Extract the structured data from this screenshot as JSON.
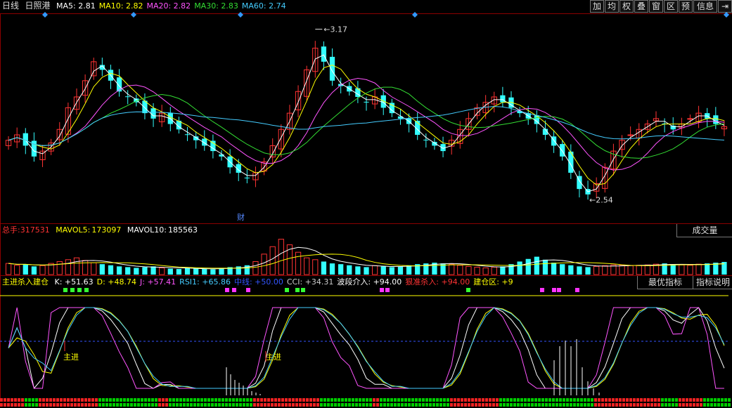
{
  "header": {
    "period": "日线",
    "stock": "日照港",
    "ma": [
      {
        "label": "MA5:",
        "value": "2.81",
        "color": "#ffffff"
      },
      {
        "label": "MA10:",
        "value": "2.82",
        "color": "#ffff00"
      },
      {
        "label": "MA20:",
        "value": "2.82",
        "color": "#ff55ff"
      },
      {
        "label": "MA30:",
        "value": "2.83",
        "color": "#33dd33"
      },
      {
        "label": "MA60:",
        "value": "2.74",
        "color": "#44ccff"
      }
    ]
  },
  "toolbar": {
    "items": [
      "加",
      "均",
      "权",
      "叠",
      "窗",
      "区",
      "预",
      "信息"
    ],
    "exit_icon": "exit-arrow-icon"
  },
  "main_chart": {
    "high_label": "3.17",
    "low_label": "2.54",
    "finance_marker": "财"
  },
  "volume_panel": {
    "total_label": "总手:",
    "total_value": "317531",
    "mavol5_label": "MAVOL5:",
    "mavol5_value": "173097",
    "mavol10_label": "MAVOL10:",
    "mavol10_value": "185563",
    "button": "成交量"
  },
  "indicator_panel": {
    "name": "主进杀入建仓",
    "items": [
      {
        "label": "K:",
        "value": "+51.63",
        "color": "#ffffff"
      },
      {
        "label": "D:",
        "value": "+48.74",
        "color": "#ffff00"
      },
      {
        "label": "J:",
        "value": "+57.41",
        "color": "#ff55ff"
      },
      {
        "label": "RSI1:",
        "value": "+65.86",
        "color": "#44ccff"
      },
      {
        "label": "中线:",
        "value": "+50.00",
        "color": "#3355ff"
      },
      {
        "label": "CCI:",
        "value": "+34.31",
        "color": "#cccccc"
      },
      {
        "label": "波段介入:",
        "value": "+94.00",
        "color": "#ffffff"
      },
      {
        "label": "狠准杀入:",
        "value": "+94.00",
        "color": "#ff3333"
      },
      {
        "label": "建仓区:",
        "value": "+9",
        "color": "#ffff00"
      }
    ],
    "button_best": "最优指标",
    "button_help": "指标说明",
    "annotations": [
      "主进",
      "主进"
    ]
  },
  "colors": {
    "up": "#ff3333",
    "down": "#33ffff",
    "ma5": "#ffffff",
    "ma10": "#ffff00",
    "ma20": "#ff55ff",
    "ma30": "#33dd33",
    "ma60": "#44ccff"
  },
  "chart_data": {
    "type": "candlestick",
    "yaxis_labels_shown": [
      "3.17",
      "2.54"
    ],
    "high": 3.17,
    "low": 2.54,
    "closes": [
      2.76,
      2.78,
      2.74,
      2.7,
      2.72,
      2.75,
      2.8,
      2.88,
      2.92,
      2.98,
      3.05,
      3.02,
      2.98,
      2.94,
      2.92,
      2.9,
      2.86,
      2.84,
      2.86,
      2.82,
      2.8,
      2.78,
      2.76,
      2.74,
      2.72,
      2.7,
      2.66,
      2.64,
      2.62,
      2.64,
      2.68,
      2.74,
      2.8,
      2.86,
      2.94,
      3.02,
      3.1,
      3.05,
      2.98,
      2.96,
      2.94,
      2.92,
      2.9,
      2.92,
      2.88,
      2.86,
      2.84,
      2.82,
      2.78,
      2.76,
      2.74,
      2.72,
      2.76,
      2.8,
      2.84,
      2.88,
      2.9,
      2.92,
      2.9,
      2.88,
      2.86,
      2.84,
      2.82,
      2.78,
      2.74,
      2.7,
      2.64,
      2.58,
      2.56,
      2.6,
      2.66,
      2.72,
      2.76,
      2.78,
      2.8,
      2.82,
      2.84,
      2.82,
      2.8,
      2.82,
      2.84,
      2.86,
      2.84,
      2.82,
      2.81
    ],
    "volume": [
      0.3,
      0.25,
      0.28,
      0.22,
      0.24,
      0.3,
      0.35,
      0.4,
      0.45,
      0.38,
      0.32,
      0.28,
      0.25,
      0.22,
      0.2,
      0.18,
      0.2,
      0.22,
      0.18,
      0.16,
      0.15,
      0.17,
      0.16,
      0.15,
      0.14,
      0.18,
      0.2,
      0.22,
      0.25,
      0.35,
      0.55,
      0.75,
      0.95,
      0.8,
      0.6,
      0.45,
      0.4,
      0.35,
      0.3,
      0.28,
      0.25,
      0.22,
      0.2,
      0.24,
      0.22,
      0.2,
      0.22,
      0.25,
      0.28,
      0.3,
      0.32,
      0.3,
      0.28,
      0.25,
      0.22,
      0.2,
      0.18,
      0.2,
      0.22,
      0.28,
      0.35,
      0.42,
      0.48,
      0.4,
      0.32,
      0.28,
      0.25,
      0.22,
      0.2,
      0.22,
      0.24,
      0.26,
      0.25,
      0.24,
      0.25,
      0.26,
      0.28,
      0.3,
      0.28,
      0.26,
      0.25,
      0.28,
      0.3,
      0.32,
      0.34
    ]
  }
}
